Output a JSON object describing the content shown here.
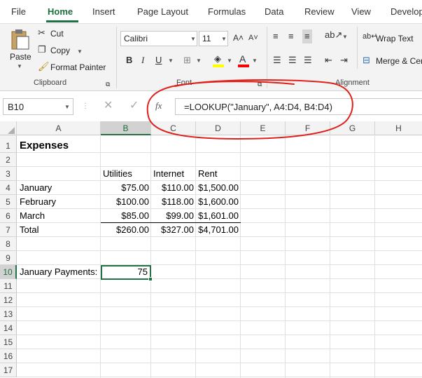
{
  "tabs": [
    "File",
    "Home",
    "Insert",
    "Page Layout",
    "Formulas",
    "Data",
    "Review",
    "View",
    "Develop"
  ],
  "ribbon": {
    "clipboard": {
      "paste": "Paste",
      "cut": "Cut",
      "copy": "Copy",
      "format_painter": "Format Painter",
      "label": "Clipboard"
    },
    "font": {
      "name": "Calibri",
      "size": "11",
      "label": "Font",
      "bold": "B",
      "italic": "I",
      "underline": "U"
    },
    "alignment": {
      "wrap_text": "Wrap Text",
      "merge": "Merge & Cer",
      "label": "Alignment"
    },
    "colors": {
      "highlight": "#ffff00",
      "font_color": "#ff0000"
    }
  },
  "formula_bar": {
    "name_box": "B10",
    "fx": "fx",
    "formula": "=LOOKUP(\"January\", A4:D4,  B4:D4)"
  },
  "columns": [
    "A",
    "B",
    "C",
    "D",
    "E",
    "F",
    "G",
    "H"
  ],
  "rows": [
    "1",
    "2",
    "3",
    "4",
    "5",
    "6",
    "7",
    "8",
    "9",
    "10",
    "11",
    "12",
    "13",
    "14",
    "15",
    "16",
    "17"
  ],
  "sheet": {
    "title": "Expenses",
    "headers": [
      "Utilities",
      "Internet",
      "Rent"
    ],
    "data": [
      {
        "label": "January",
        "values": [
          "$75.00",
          "$110.00",
          "$1,500.00"
        ]
      },
      {
        "label": "February",
        "values": [
          "$100.00",
          "$118.00",
          "$1,600.00"
        ]
      },
      {
        "label": "March",
        "values": [
          "$85.00",
          "$99.00",
          "$1,601.00"
        ]
      },
      {
        "label": "Total",
        "values": [
          "$260.00",
          "$327.00",
          "$4,701.00"
        ]
      }
    ],
    "lookup_label": "January Payments:",
    "lookup_value": "75"
  },
  "annotation_color": "#e0201b"
}
